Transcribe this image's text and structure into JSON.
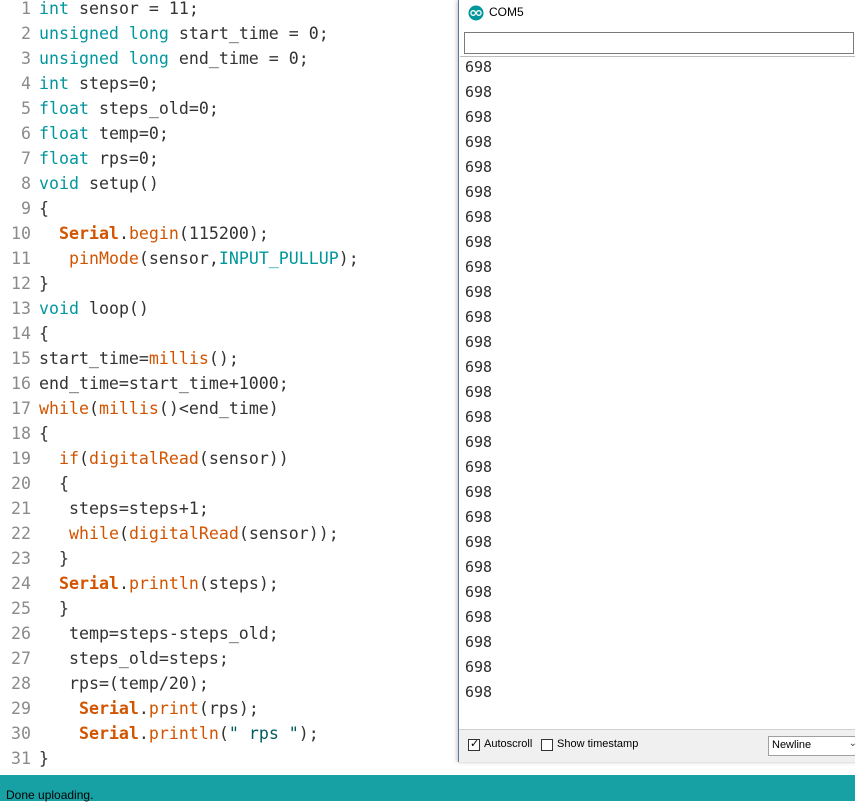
{
  "editor": {
    "lines": [
      {
        "n": "1",
        "t": [
          [
            "kw",
            "int"
          ],
          [
            "",
            "sensor = 11;"
          ]
        ]
      },
      {
        "n": "2",
        "t": [
          [
            "kw",
            "unsigned long"
          ],
          [
            "",
            "start_time = 0;"
          ]
        ]
      },
      {
        "n": "3",
        "t": [
          [
            "kw",
            "unsigned long"
          ],
          [
            "",
            "end_time = 0;"
          ]
        ]
      },
      {
        "n": "4",
        "t": [
          [
            "kw",
            "int"
          ],
          [
            "",
            "steps=0;"
          ]
        ]
      },
      {
        "n": "5",
        "t": [
          [
            "kw",
            "float"
          ],
          [
            "",
            "steps_old=0;"
          ]
        ]
      },
      {
        "n": "6",
        "t": [
          [
            "kw",
            "float"
          ],
          [
            "",
            "temp=0;"
          ]
        ]
      },
      {
        "n": "7",
        "t": [
          [
            "kw",
            "float"
          ],
          [
            "",
            "rps=0;"
          ]
        ]
      },
      {
        "n": "8",
        "t": [
          [
            "kw",
            "void"
          ],
          [
            "",
            "setup()"
          ]
        ]
      },
      {
        "n": "9",
        "t": [
          [
            "",
            "{"
          ]
        ]
      },
      {
        "n": "10",
        "t": [
          [
            "",
            "  "
          ],
          [
            "fn-b",
            "Serial"
          ],
          [
            "",
            "."
          ],
          [
            "fn",
            "begin"
          ],
          [
            "",
            "(115200);"
          ]
        ]
      },
      {
        "n": "11",
        "t": [
          [
            "",
            "   "
          ],
          [
            "fn",
            "pinMode"
          ],
          [
            "",
            "(sensor,"
          ],
          [
            "lit",
            "INPUT_PULLUP"
          ],
          [
            "",
            ");"
          ]
        ]
      },
      {
        "n": "12",
        "t": [
          [
            "",
            "}"
          ]
        ]
      },
      {
        "n": "13",
        "t": [
          [
            "kw",
            "void"
          ],
          [
            "",
            "loop()"
          ]
        ]
      },
      {
        "n": "14",
        "t": [
          [
            "",
            "{"
          ]
        ]
      },
      {
        "n": "15",
        "t": [
          [
            "",
            "start_time="
          ],
          [
            "fn",
            "millis"
          ],
          [
            "",
            "();"
          ]
        ]
      },
      {
        "n": "16",
        "t": [
          [
            "",
            "end_time=start_time+1000;"
          ]
        ]
      },
      {
        "n": "17",
        "t": [
          [
            "fn",
            "while"
          ],
          [
            "",
            "("
          ],
          [
            "fn",
            "millis"
          ],
          [
            "",
            "()<end_time)"
          ]
        ]
      },
      {
        "n": "18",
        "t": [
          [
            "",
            "{"
          ]
        ]
      },
      {
        "n": "19",
        "t": [
          [
            "",
            "  "
          ],
          [
            "fn",
            "if"
          ],
          [
            "",
            "("
          ],
          [
            "fn",
            "digitalRead"
          ],
          [
            "",
            "(sensor))"
          ]
        ]
      },
      {
        "n": "20",
        "t": [
          [
            "",
            "  {"
          ]
        ]
      },
      {
        "n": "21",
        "t": [
          [
            "",
            "   steps=steps+1;"
          ]
        ]
      },
      {
        "n": "22",
        "t": [
          [
            "",
            "   "
          ],
          [
            "fn",
            "while"
          ],
          [
            "",
            "("
          ],
          [
            "fn",
            "digitalRead"
          ],
          [
            "",
            "(sensor));"
          ]
        ]
      },
      {
        "n": "23",
        "t": [
          [
            "",
            "  }"
          ]
        ]
      },
      {
        "n": "24",
        "t": [
          [
            "",
            "  "
          ],
          [
            "fn-b",
            "Serial"
          ],
          [
            "",
            "."
          ],
          [
            "fn",
            "println"
          ],
          [
            "",
            "(steps);"
          ]
        ]
      },
      {
        "n": "25",
        "t": [
          [
            "",
            "  }"
          ]
        ]
      },
      {
        "n": "26",
        "t": [
          [
            "",
            "   temp=steps-steps_old;"
          ]
        ]
      },
      {
        "n": "27",
        "t": [
          [
            "",
            "   steps_old=steps;"
          ]
        ]
      },
      {
        "n": "28",
        "t": [
          [
            "",
            "   rps=(temp/20);"
          ]
        ]
      },
      {
        "n": "29",
        "t": [
          [
            "",
            "    "
          ],
          [
            "fn-b",
            "Serial"
          ],
          [
            "",
            "."
          ],
          [
            "fn",
            "print"
          ],
          [
            "",
            "(rps);"
          ]
        ]
      },
      {
        "n": "30",
        "t": [
          [
            "",
            "    "
          ],
          [
            "fn-b",
            "Serial"
          ],
          [
            "",
            "."
          ],
          [
            "fn",
            "println"
          ],
          [
            "",
            "("
          ],
          [
            "str",
            "\" rps \""
          ],
          [
            "",
            ");"
          ]
        ]
      },
      {
        "n": "31",
        "t": [
          [
            "",
            "}"
          ]
        ]
      }
    ]
  },
  "serial_monitor": {
    "title": "COM5",
    "input_value": "",
    "output_lines": [
      "698",
      "698",
      "698",
      "698",
      "698",
      "698",
      "698",
      "698",
      "698",
      "698",
      "698",
      "698",
      "698",
      "698",
      "698",
      "698",
      "698",
      "698",
      "698",
      "698",
      "698",
      "698",
      "698",
      "698",
      "698",
      "698"
    ],
    "autoscroll_label": "Autoscroll",
    "autoscroll_checked": true,
    "show_timestamp_label": "Show timestamp",
    "show_timestamp_checked": false,
    "line_ending": "Newline"
  },
  "status": {
    "text": "Done uploading."
  },
  "colors": {
    "keyword": "#00979d",
    "function": "#d35400",
    "status_bar": "#17a1a5"
  }
}
